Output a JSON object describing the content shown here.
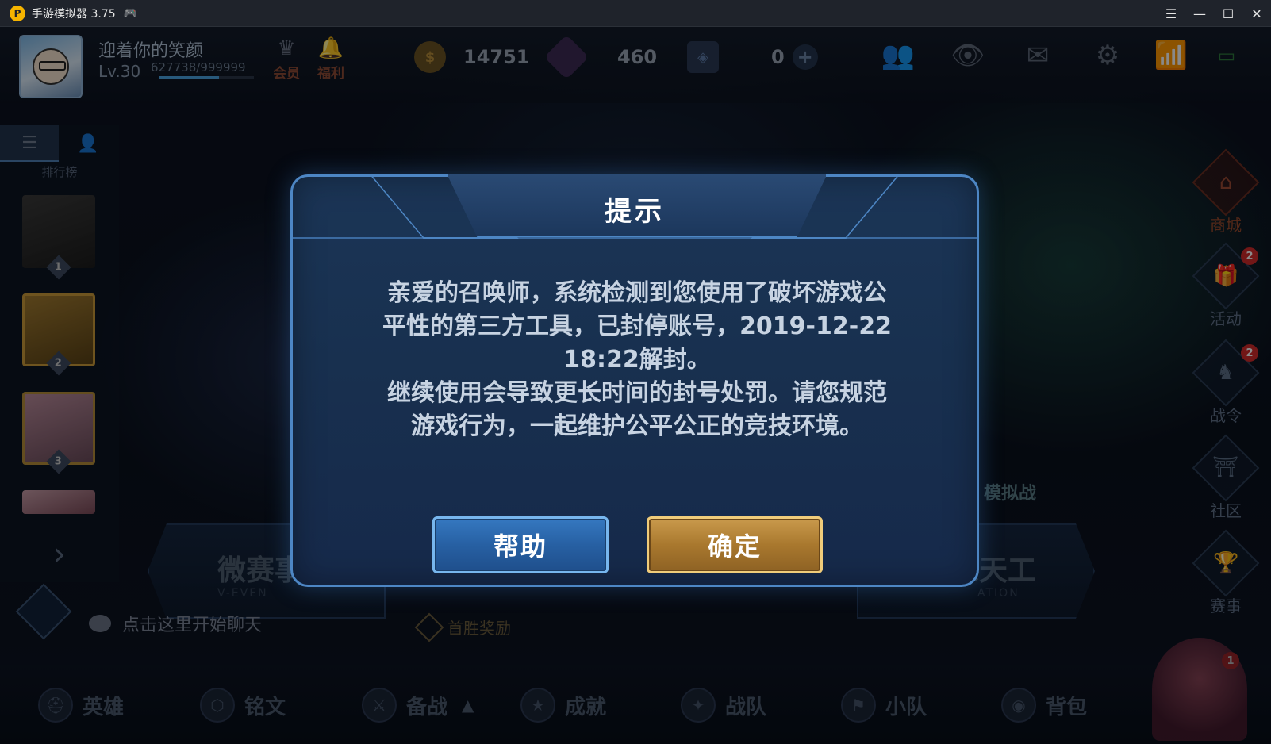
{
  "emulator": {
    "title": "手游模拟器 3.75",
    "logo_glyph": "P",
    "icons": [
      "gamepad-icon",
      "menu-icon",
      "minimize-icon",
      "maximize-icon",
      "close-icon"
    ]
  },
  "player": {
    "name": "迎着你的笑颜",
    "level": "Lv.30",
    "exp": "627738/999999",
    "exp_fraction": 0.63
  },
  "top_links": [
    {
      "label": "会员",
      "icon": "vip-icon"
    },
    {
      "label": "福利",
      "icon": "bell-icon"
    }
  ],
  "currency": {
    "gold": "14751",
    "diamond": "460",
    "voucher": "0"
  },
  "leftpanel": {
    "label": "排行榜",
    "ranks": [
      "1",
      "2",
      "3"
    ]
  },
  "rightnav": [
    {
      "label": "商城",
      "badge": ""
    },
    {
      "label": "活动",
      "badge": "2"
    },
    {
      "label": "战令",
      "badge": "2"
    },
    {
      "label": "社区",
      "badge": ""
    },
    {
      "label": "赛事",
      "badge": ""
    }
  ],
  "background": {
    "banner_left_title": "微赛事",
    "banner_left_sub": "V-EVEN",
    "banner_right_title": "万象天工",
    "banner_right_sub": "ATION",
    "sim_label": "模拟战",
    "first_win": "首胜奖励",
    "chat_placeholder": "点击这里开始聊天"
  },
  "bottomnav": [
    {
      "label": "英雄"
    },
    {
      "label": "铭文"
    },
    {
      "label": "备战"
    },
    {
      "label": "成就"
    },
    {
      "label": "战队"
    },
    {
      "label": "小队"
    },
    {
      "label": "背包"
    }
  ],
  "bottom_char_badge": "1",
  "dialog": {
    "title": "提示",
    "line1": "亲爱的召唤师，系统检测到您使用了破坏游戏公",
    "line2": "平性的第三方工具，已封停账号，2019-12-22",
    "line3": "18:22解封。",
    "line4": "继续使用会导致更长时间的封号处罚。请您规范",
    "line5": "游戏行为，一起维护公平公正的竞技环境。",
    "help_label": "帮助",
    "ok_label": "确定"
  },
  "colors": {
    "dialog_border": "#4d86c4",
    "help_button": "#2760a3",
    "ok_button": "#a9782e"
  }
}
